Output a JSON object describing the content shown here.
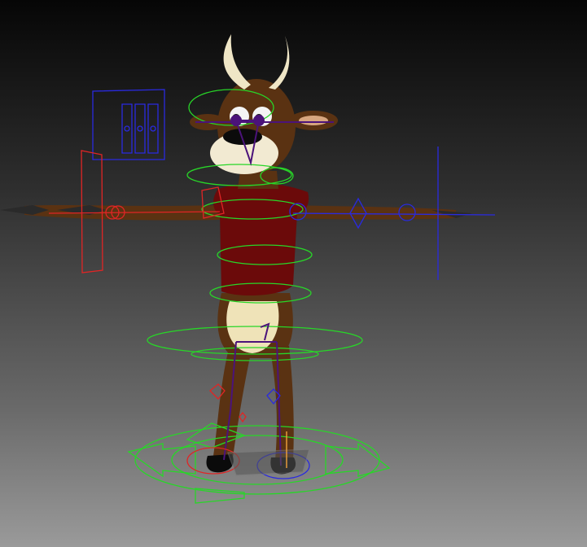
{
  "viewport": {
    "background_top": "#060606",
    "background_bottom": "#9a9a9a",
    "character": {
      "fur": "#5a3212",
      "fur_dark": "#3a1f0a",
      "shirt": "#6b0a0a",
      "belly": "#efe3b8",
      "horn": "#efe6c6",
      "muzzle": "#f2ead2",
      "hoof": "#0b0b0b"
    },
    "rig_colors": {
      "green": "#28d628",
      "blue": "#2a2adf",
      "red": "#e02525",
      "purple": "#4b137a",
      "grey": "#7a7a7a"
    },
    "controls": {
      "main_control": "main-control-icon",
      "root_control": "root-control-icon",
      "hip_control": "hip-control-icon",
      "chest_control": "chest-control-icon",
      "neck_control": "neck-control-icon",
      "head_control": "head-control-icon",
      "left_ik_arm": "arm-ik-handle-icon",
      "right_ik_arm": "arm-ik-handle-icon",
      "left_foot": "foot-control-icon",
      "right_foot": "foot-control-icon",
      "face_panel": "face-slider-panel-icon"
    }
  }
}
